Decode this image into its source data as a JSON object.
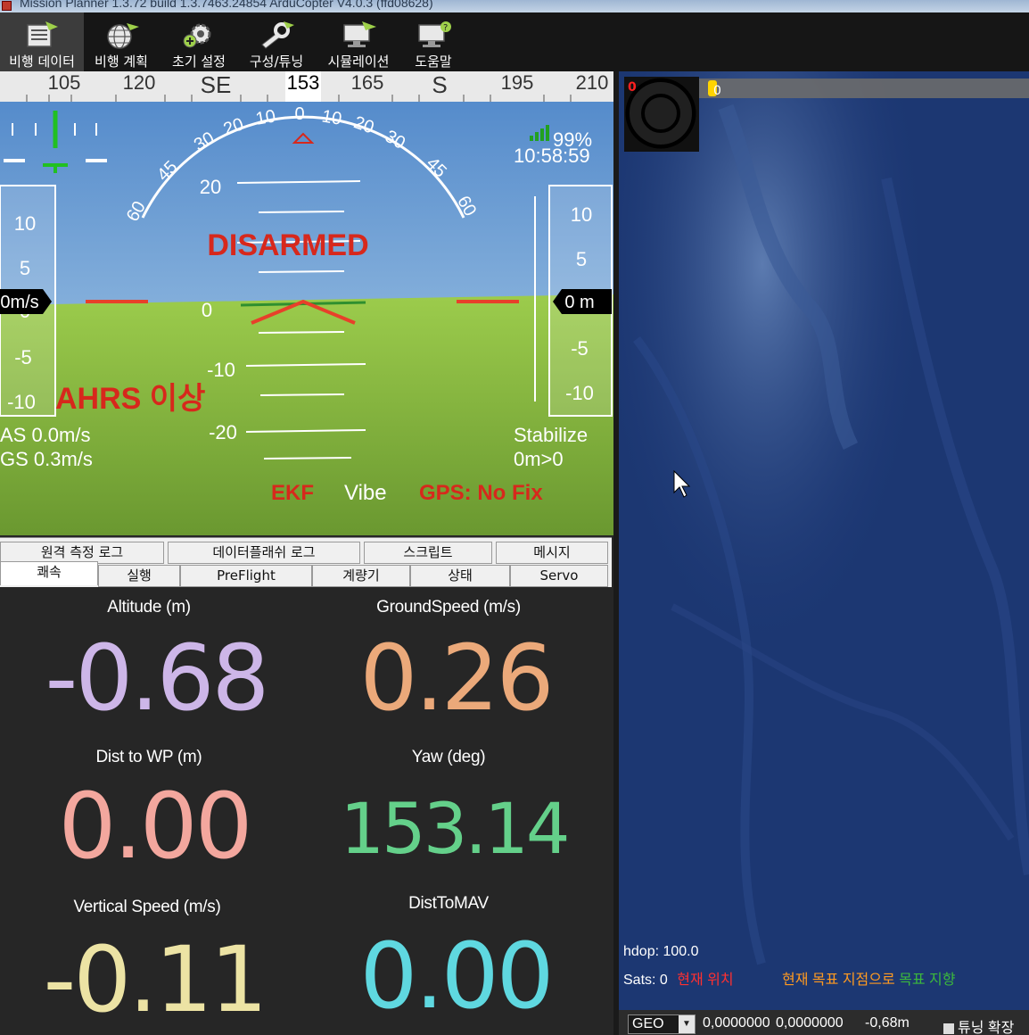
{
  "window": {
    "title": "Mission Planner 1.3.72 build 1.3.7463.24854 ArduCopter V4.0.3 (ffd08628)"
  },
  "toolbar": {
    "items": [
      {
        "label": "비행 데이터",
        "icon": "flight-data-icon"
      },
      {
        "label": "비행 계획",
        "icon": "flight-plan-icon"
      },
      {
        "label": "초기 설정",
        "icon": "initial-setup-icon"
      },
      {
        "label": "구성/튜닝",
        "icon": "config-tuning-icon"
      },
      {
        "label": "시뮬레이션",
        "icon": "simulation-icon"
      },
      {
        "label": "도움말",
        "icon": "help-icon"
      }
    ]
  },
  "hud": {
    "heading_ticks": [
      "105",
      "120",
      "SE",
      "165",
      "S",
      "195",
      "210"
    ],
    "heading_value": "153",
    "roll_labels": [
      "60",
      "45",
      "30",
      "20",
      "10",
      "0",
      "10",
      "20",
      "30",
      "45",
      "60"
    ],
    "pitch_labels": [
      "20",
      "0",
      "-10",
      "-20"
    ],
    "speed_ticks": [
      "10",
      "5",
      "0",
      "-5",
      "-10"
    ],
    "speed_value": "0m/s",
    "alt_ticks": [
      "10",
      "5",
      "-5",
      "-10"
    ],
    "alt_value": "0 m",
    "battery": "99%",
    "time": "10:58:59",
    "armed_status": "DISARMED",
    "ahrs_warning": "AHRS 이상",
    "airspeed": "AS 0.0m/s",
    "groundspeed": "GS 0.3m/s",
    "mode": "Stabilize",
    "wp_info": "0m>0",
    "ekf": "EKF",
    "vibe": "Vibe",
    "gps": "GPS: No Fix",
    "colors": {
      "warning": "#d7281c",
      "sky": "#7fb0d8",
      "ground": "#8dbb44"
    }
  },
  "tabs": {
    "row1": [
      "원격 측정 로그",
      "데이터플래쉬 로그",
      "스크립트",
      "메시지"
    ],
    "row2": [
      "쾌속",
      "실행",
      "PreFlight",
      "계량기",
      "상태",
      "Servo"
    ]
  },
  "quick": {
    "items": [
      {
        "label": "Altitude (m)",
        "value": "-0.68",
        "color": "#cdb6e8"
      },
      {
        "label": "GroundSpeed (m/s)",
        "value": "0.26",
        "color": "#eba97a"
      },
      {
        "label": "Dist to WP (m)",
        "value": "0.00",
        "color": "#f3a79e"
      },
      {
        "label": "Yaw (deg)",
        "value": "153.14",
        "color": "#64d08a"
      },
      {
        "label": "Vertical Speed (m/s)",
        "value": "-0.11",
        "color": "#ece3a4"
      },
      {
        "label": "DistToMAV",
        "value": "0.00",
        "color": "#5fd8e0"
      }
    ]
  },
  "map": {
    "hdop": "hdop: 100.0",
    "sats": "Sats: 0",
    "legend_current": "현재 위치",
    "legend_target": "현재 목표 지점으로",
    "legend_heading": "목표 지향",
    "zoom_marker": "0",
    "top_marker": "0",
    "geo": "GEO",
    "lat": "0,0000000",
    "lng": "0,0000000",
    "alt": "-0,68m",
    "tune_label": "튜닝 확장"
  }
}
